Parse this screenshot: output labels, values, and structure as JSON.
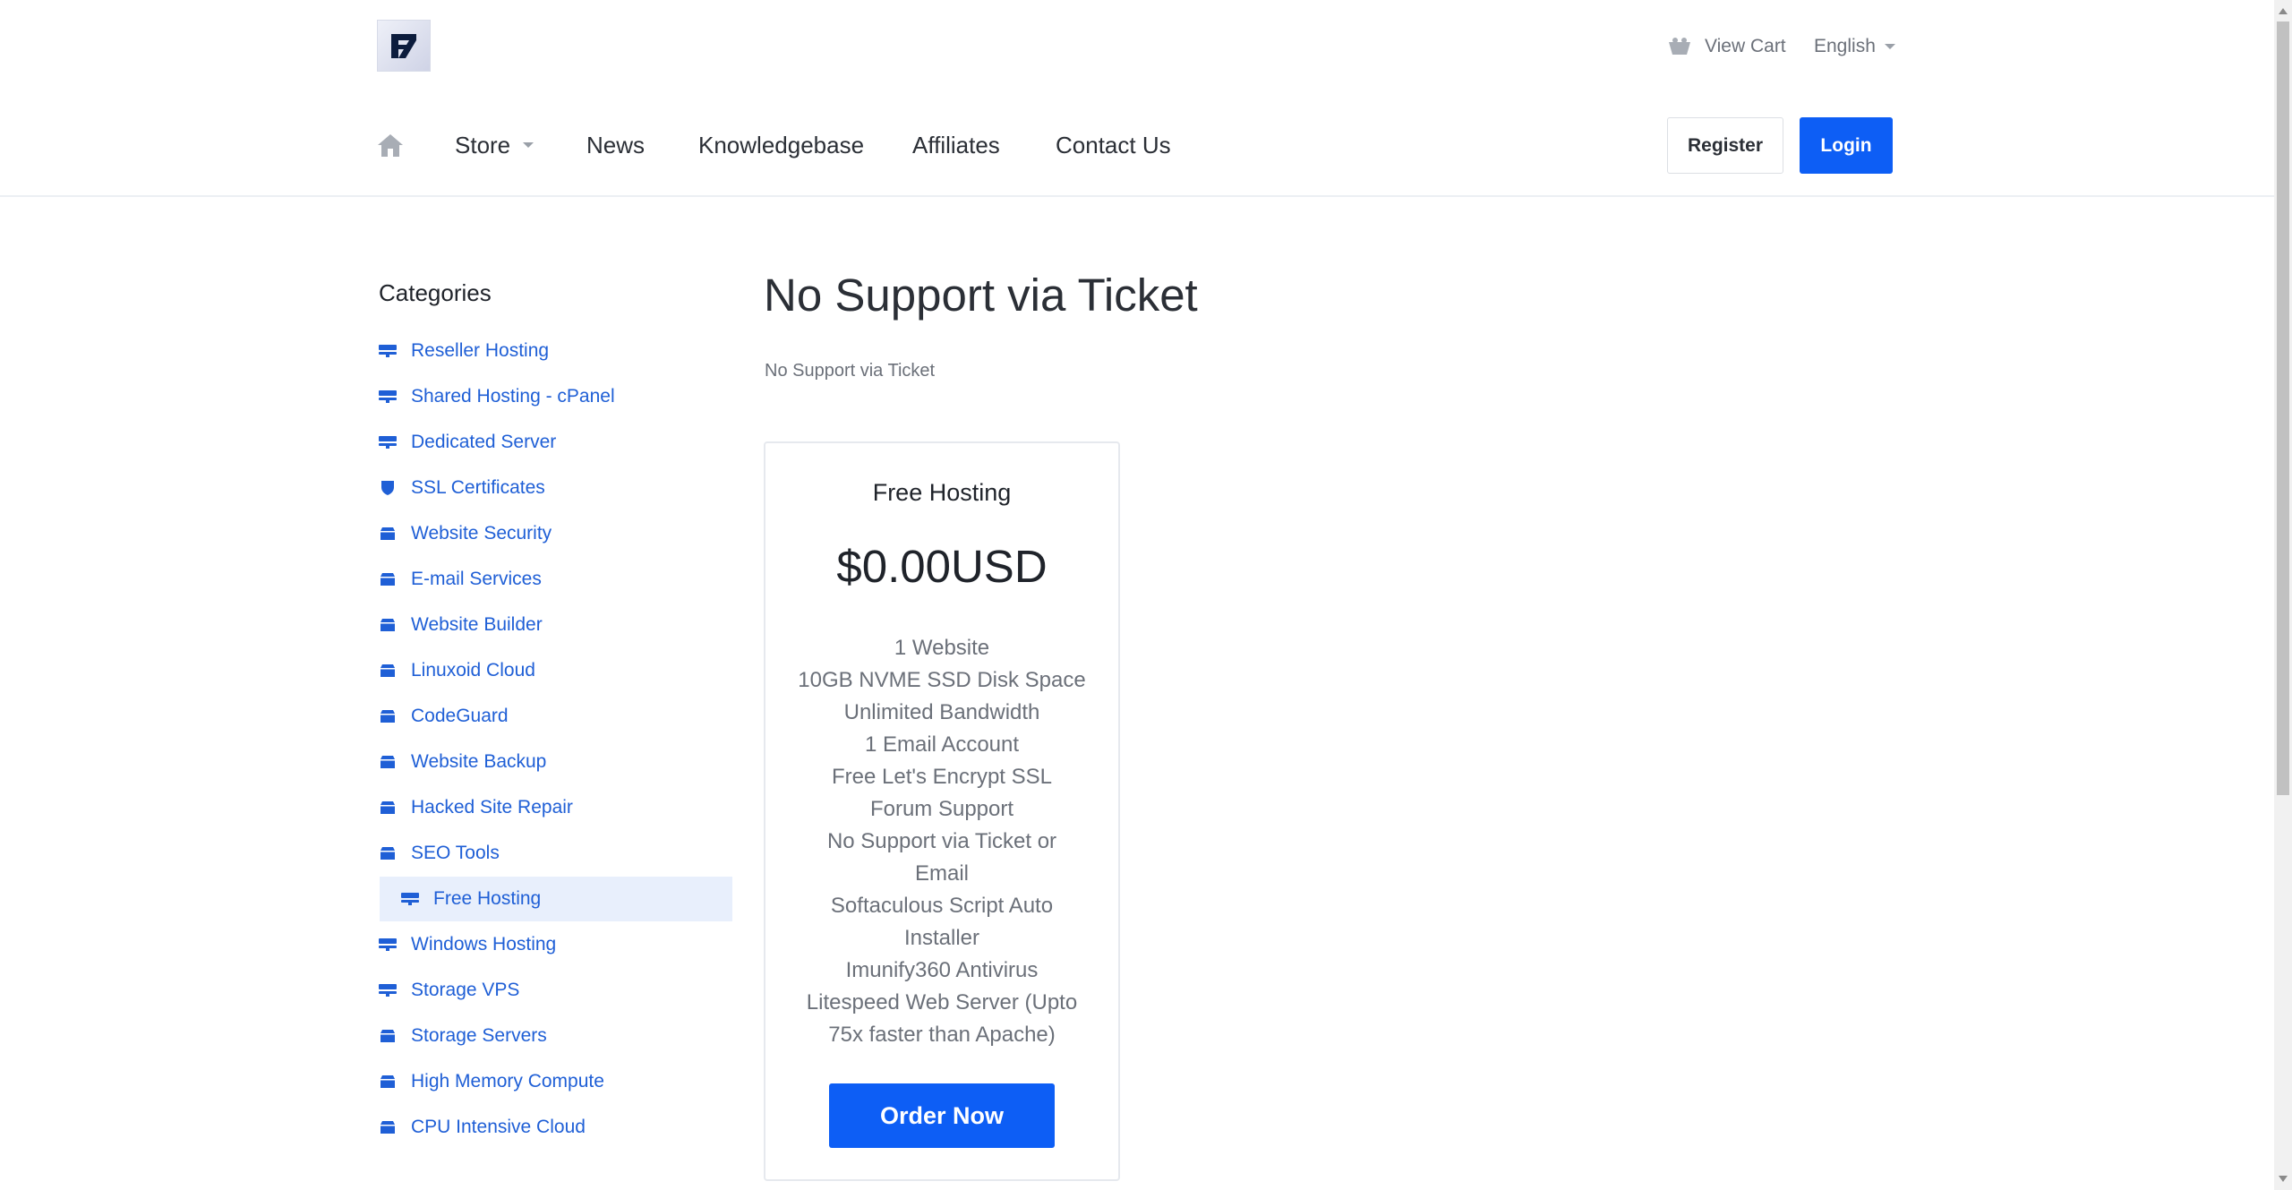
{
  "header": {
    "logo_text": "F7",
    "cart_label": "View Cart",
    "language_label": "English",
    "register_label": "Register",
    "login_label": "Login"
  },
  "nav": {
    "items": [
      {
        "label": "Store"
      },
      {
        "label": "News"
      },
      {
        "label": "Knowledgebase"
      },
      {
        "label": "Affiliates"
      },
      {
        "label": "Contact Us"
      }
    ]
  },
  "sidebar": {
    "title": "Categories",
    "items": [
      {
        "label": "Reseller Hosting",
        "icon": "server-icon"
      },
      {
        "label": "Shared Hosting - cPanel",
        "icon": "server-icon"
      },
      {
        "label": "Dedicated Server",
        "icon": "server-icon"
      },
      {
        "label": "SSL Certificates",
        "icon": "shield-icon"
      },
      {
        "label": "Website Security",
        "icon": "box-icon"
      },
      {
        "label": "E-mail Services",
        "icon": "box-icon"
      },
      {
        "label": "Website Builder",
        "icon": "box-icon"
      },
      {
        "label": "Linuxoid Cloud",
        "icon": "box-icon"
      },
      {
        "label": "CodeGuard",
        "icon": "box-icon"
      },
      {
        "label": "Website Backup",
        "icon": "box-icon"
      },
      {
        "label": "Hacked Site Repair",
        "icon": "box-icon"
      },
      {
        "label": "SEO Tools",
        "icon": "box-icon"
      },
      {
        "label": "Free Hosting",
        "icon": "server-icon",
        "active": true
      },
      {
        "label": "Windows Hosting",
        "icon": "server-icon"
      },
      {
        "label": "Storage VPS",
        "icon": "server-icon"
      },
      {
        "label": "Storage Servers",
        "icon": "box-icon"
      },
      {
        "label": "High Memory Compute",
        "icon": "box-icon"
      },
      {
        "label": "CPU Intensive Cloud",
        "icon": "box-icon"
      }
    ]
  },
  "main": {
    "title": "No Support via Ticket",
    "subtitle": "No Support via Ticket",
    "product": {
      "name": "Free Hosting",
      "price": "$0.00USD",
      "features": [
        "1 Website",
        "10GB NVME SSD Disk Space",
        "Unlimited Bandwidth",
        "1 Email Account",
        "Free Let's Encrypt SSL",
        "Forum Support",
        "No Support via Ticket or",
        "Email",
        "Softaculous Script Auto",
        "Installer",
        "Imunify360 Antivirus",
        "Litespeed Web Server (Upto",
        "75x faster than Apache)"
      ],
      "order_label": "Order Now"
    }
  },
  "colors": {
    "accent": "#0d5ef5",
    "link": "#1f5fd6",
    "active_bg": "#e8effc"
  }
}
